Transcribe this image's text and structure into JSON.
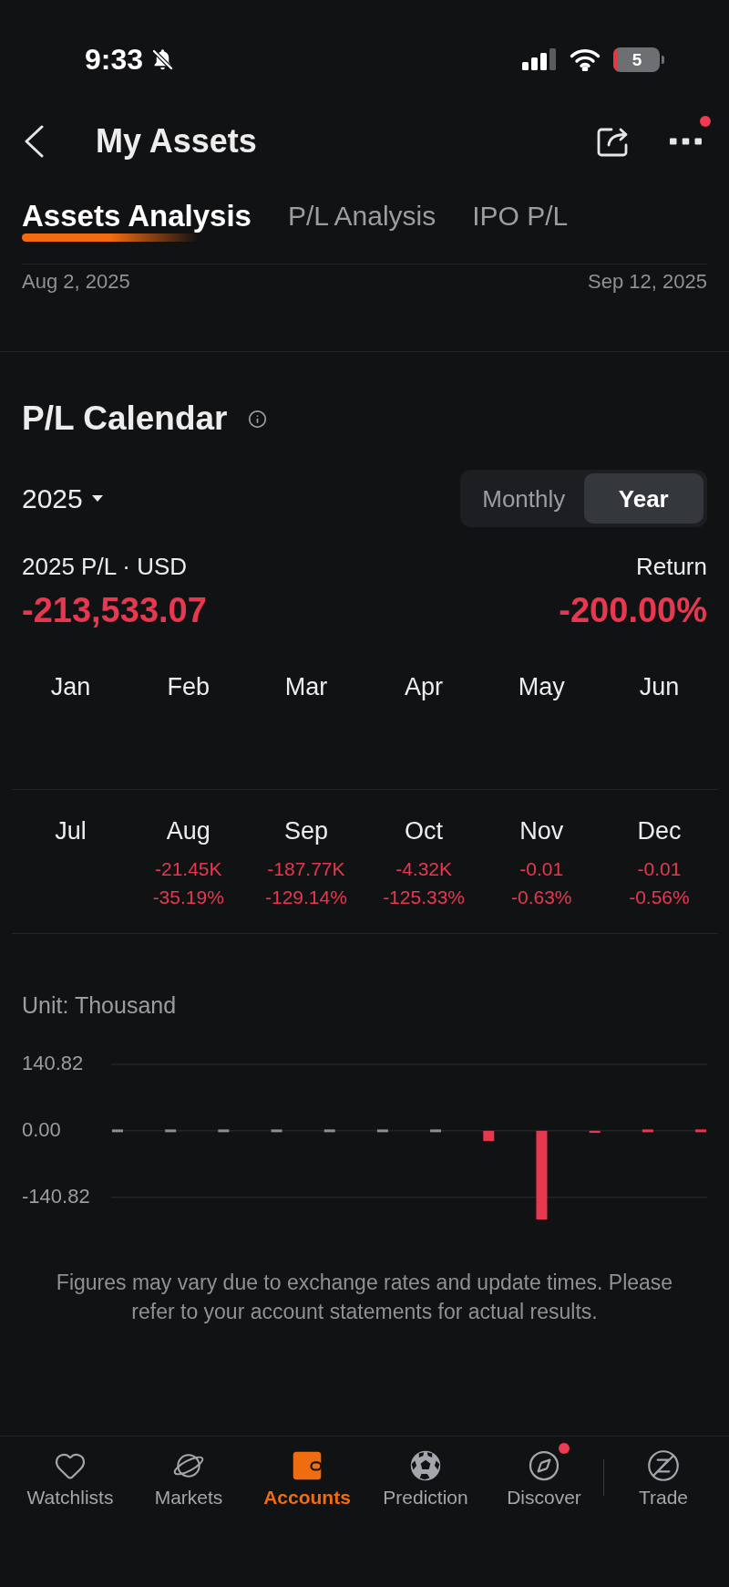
{
  "status_bar": {
    "time": "9:33",
    "battery": "5"
  },
  "header": {
    "title": "My Assets",
    "more_badge": true
  },
  "tabs": [
    {
      "label": "Assets Analysis",
      "selected": true
    },
    {
      "label": "P/L Analysis",
      "selected": false
    },
    {
      "label": "IPO P/L",
      "selected": false
    }
  ],
  "date_range": {
    "start": "Aug 2, 2025",
    "end": "Sep 12, 2025"
  },
  "pl_calendar": {
    "title": "P/L Calendar",
    "year": "2025",
    "modes": [
      {
        "label": "Monthly",
        "selected": false
      },
      {
        "label": "Year",
        "selected": true
      }
    ],
    "total_label": "2025 P/L · USD",
    "total": "-213,533.07",
    "return_label": "Return",
    "return": "-200.00%",
    "months": [
      {
        "label": "Jan"
      },
      {
        "label": "Feb"
      },
      {
        "label": "Mar"
      },
      {
        "label": "Apr"
      },
      {
        "label": "May"
      },
      {
        "label": "Jun"
      },
      {
        "label": "Jul"
      },
      {
        "label": "Aug",
        "pl": "-21.45K",
        "return": "-35.19%"
      },
      {
        "label": "Sep",
        "pl": "-187.77K",
        "return": "-129.14%"
      },
      {
        "label": "Oct",
        "pl": "-4.32K",
        "return": "-125.33%"
      },
      {
        "label": "Nov",
        "pl": "-0.01",
        "return": "-0.63%"
      },
      {
        "label": "Dec",
        "pl": "-0.01",
        "return": "-0.56%"
      }
    ],
    "unit": "Unit: Thousand",
    "chart_data": {
      "type": "bar",
      "values": [
        0,
        0,
        0,
        0,
        0,
        0,
        0,
        -21.45,
        -187.77,
        -4.32,
        -0.01,
        -0.01
      ],
      "ylim": [
        -187.77,
        140.82
      ],
      "yticks": [
        {
          "value": 140.82,
          "label": "140.82"
        },
        {
          "value": 0,
          "label": "0.00"
        },
        {
          "value": -140.82,
          "label": "-140.82"
        }
      ]
    },
    "disclaimer": "Figures may vary due to exchange rates and update times. Please refer to your account statements for actual results."
  },
  "bottom_nav": [
    {
      "label": "Watchlists",
      "selected": false,
      "badge": false
    },
    {
      "label": "Markets",
      "selected": false,
      "badge": false
    },
    {
      "label": "Accounts",
      "selected": true,
      "badge": false
    },
    {
      "label": "Prediction",
      "selected": false,
      "badge": false
    },
    {
      "label": "Discover",
      "selected": false,
      "badge": true
    },
    {
      "label": "Trade",
      "selected": false,
      "badge": false
    }
  ]
}
